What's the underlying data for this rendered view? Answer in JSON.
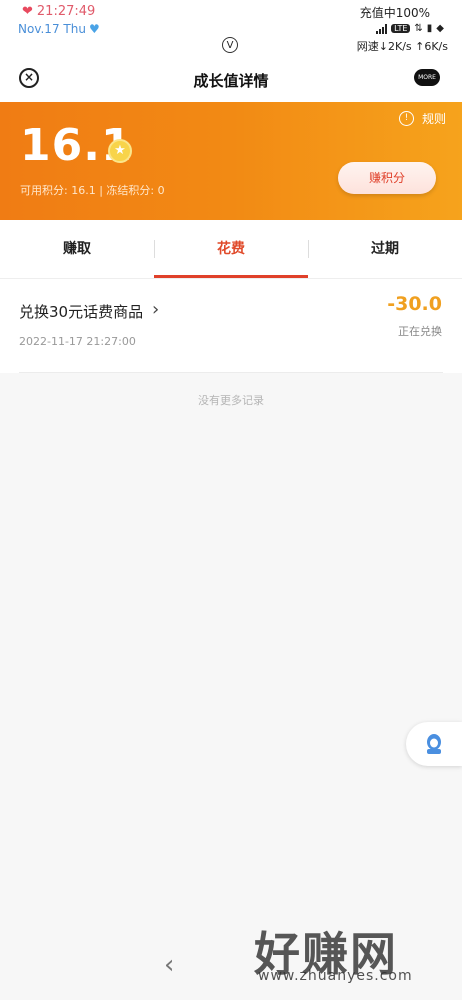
{
  "status_bar": {
    "time": "21:27:49",
    "date": "Nov.17 Thu",
    "charging": "充值中100%",
    "network_type": "LTE",
    "speed": "网速↓2K/s ↑6K/s",
    "center_icon": "V"
  },
  "header": {
    "title": "成长值详情",
    "more_label": "MORE"
  },
  "hero": {
    "points": "16.1",
    "rules_label": "规则",
    "available_label": "可用积分: 16.1 | 冻结积分: 0",
    "earn_button": "赚积分",
    "accent_color": "#f28a14"
  },
  "tabs": [
    {
      "label": "赚取",
      "active": false
    },
    {
      "label": "花费",
      "active": true
    },
    {
      "label": "过期",
      "active": false
    }
  ],
  "records": [
    {
      "title": "兑换30元话费商品",
      "time": "2022-11-17 21:27:00",
      "amount": "-30.0",
      "status": "正在兑换"
    }
  ],
  "no_more": "没有更多记录",
  "watermark": {
    "big": "好赚网",
    "small": "www.zhuanyes.com"
  },
  "icons": {
    "close": "close-icon",
    "more": "more-icon",
    "info": "info-icon",
    "coin": "coin-icon",
    "service": "service-icon",
    "back": "back-arrow-icon"
  }
}
